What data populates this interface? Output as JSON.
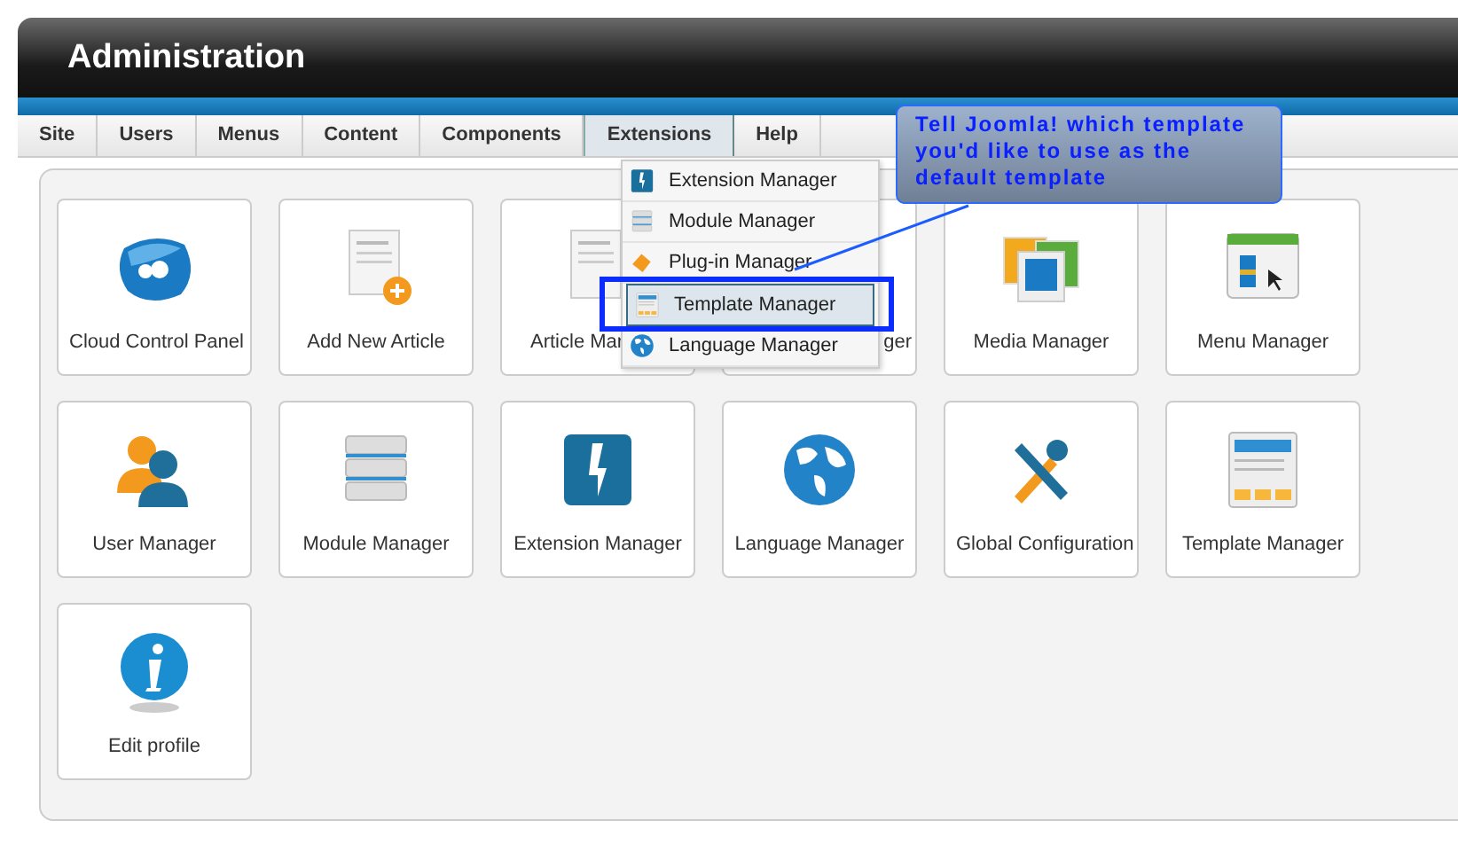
{
  "header": {
    "title": "Administration"
  },
  "menu": [
    {
      "label": "Site",
      "selected": false
    },
    {
      "label": "Users",
      "selected": false
    },
    {
      "label": "Menus",
      "selected": false
    },
    {
      "label": "Content",
      "selected": false
    },
    {
      "label": "Components",
      "selected": false
    },
    {
      "label": "Extensions",
      "selected": true
    },
    {
      "label": "Help",
      "selected": false
    }
  ],
  "dropdown": [
    {
      "label": "Extension Manager",
      "kind": "bolt",
      "selected": false
    },
    {
      "label": "Module Manager",
      "kind": "modules",
      "selected": false
    },
    {
      "label": "Plug-in Manager",
      "kind": "plugin",
      "selected": false
    },
    {
      "label": "Template Manager",
      "kind": "template",
      "selected": true
    },
    {
      "label": "Language Manager",
      "kind": "globe",
      "selected": false
    }
  ],
  "callout": {
    "text": "Tell Joomla! which template you'd like to use as the default template"
  },
  "tiles": [
    {
      "label": "Cloud Control Panel",
      "kind": "cloud"
    },
    {
      "label": "Add New Article",
      "kind": "newarticle"
    },
    {
      "label": "Article Mar",
      "kind": "article"
    },
    {
      "label": "ger",
      "kind": "covered"
    },
    {
      "label": "Media Manager",
      "kind": "media"
    },
    {
      "label": "Menu Manager",
      "kind": "menu"
    },
    {
      "label": "User Manager",
      "kind": "users"
    },
    {
      "label": "Module Manager",
      "kind": "modules"
    },
    {
      "label": "Extension Manager",
      "kind": "bolt"
    },
    {
      "label": "Language Manager",
      "kind": "globe"
    },
    {
      "label": "Global Configuration",
      "kind": "tools"
    },
    {
      "label": "Template Manager",
      "kind": "template"
    },
    {
      "label": "Edit profile",
      "kind": "info"
    }
  ]
}
